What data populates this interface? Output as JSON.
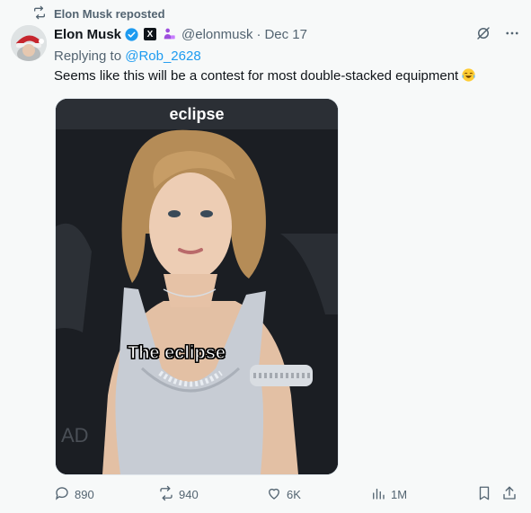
{
  "repost": {
    "label": "Elon Musk reposted",
    "icon": "repost-icon"
  },
  "author": {
    "name": "Elon Musk",
    "verified_icon": "verified-badge-icon",
    "org_badge": "X",
    "handle": "@elonmusk",
    "separator": "·",
    "date": "Dec 17"
  },
  "reply": {
    "prefix": "Replying to",
    "mention": "@Rob_2628"
  },
  "post": {
    "text": "Seems like this will be a contest for most double-stacked equipment"
  },
  "media": {
    "top_text": "eclipse",
    "caption": "The eclipse"
  },
  "actions": {
    "replies": "890",
    "reposts": "940",
    "likes": "6K",
    "views": "1M"
  },
  "colors": {
    "accent": "#1d9bf0",
    "muted": "#536471",
    "background": "#f7f9f9"
  }
}
